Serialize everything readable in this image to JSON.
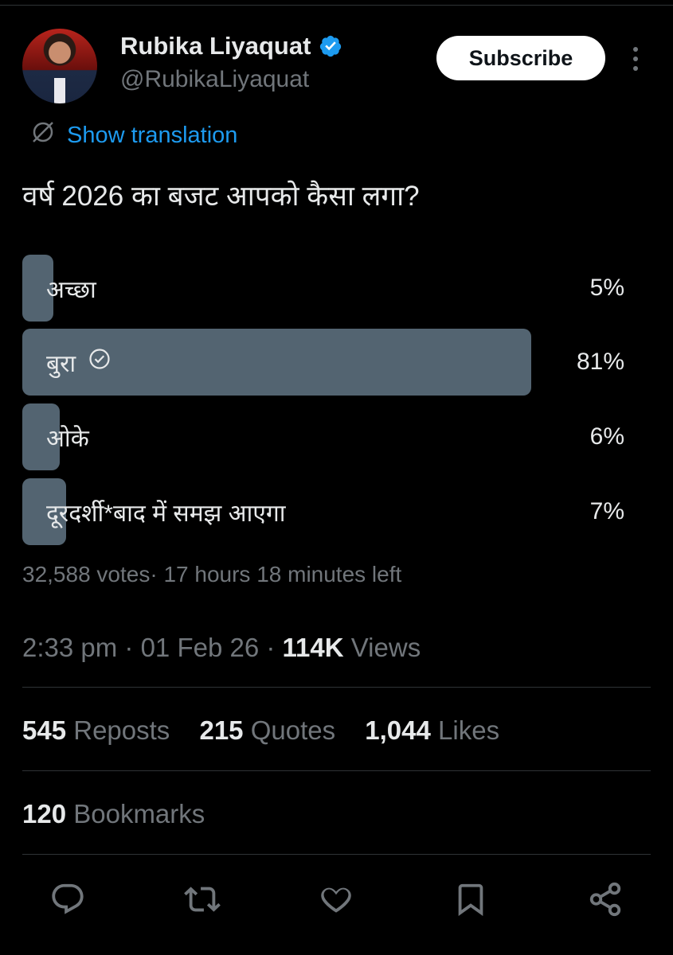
{
  "author": {
    "name": "Rubika Liyaquat",
    "handle": "@RubikaLiyaquat",
    "verified_icon": "verified-badge-icon",
    "accent_color": "#1d9bf0"
  },
  "header": {
    "subscribe_label": "Subscribe"
  },
  "translation": {
    "label": "Show translation"
  },
  "tweet": {
    "text": "वर्ष 2026 का बजट आपको कैसा लगा?"
  },
  "poll": {
    "options": [
      {
        "label": "अच्छा",
        "percent": "5%",
        "fraction": 0.05,
        "selected": false
      },
      {
        "label": "बुरा",
        "percent": "81%",
        "fraction": 0.81,
        "selected": true
      },
      {
        "label": "ओके",
        "percent": "6%",
        "fraction": 0.06,
        "selected": false
      },
      {
        "label": "दूरदर्शी*बाद में समझ आएगा",
        "percent": "7%",
        "fraction": 0.07,
        "selected": false
      }
    ],
    "summary": "32,588 votes· 17 hours 18 minutes left"
  },
  "meta": {
    "time_date": "2:33 pm · 01 Feb 26 · ",
    "views_count": "114K",
    "views_label": " Views"
  },
  "stats": {
    "reposts_count": "545",
    "reposts_label": " Reposts",
    "quotes_count": "215",
    "quotes_label": " Quotes",
    "likes_count": "1,044",
    "likes_label": " Likes",
    "bookmarks_count": "120",
    "bookmarks_label": " Bookmarks"
  },
  "action_icons": [
    "reply-icon",
    "repost-icon",
    "like-icon",
    "bookmark-icon",
    "share-icon"
  ]
}
